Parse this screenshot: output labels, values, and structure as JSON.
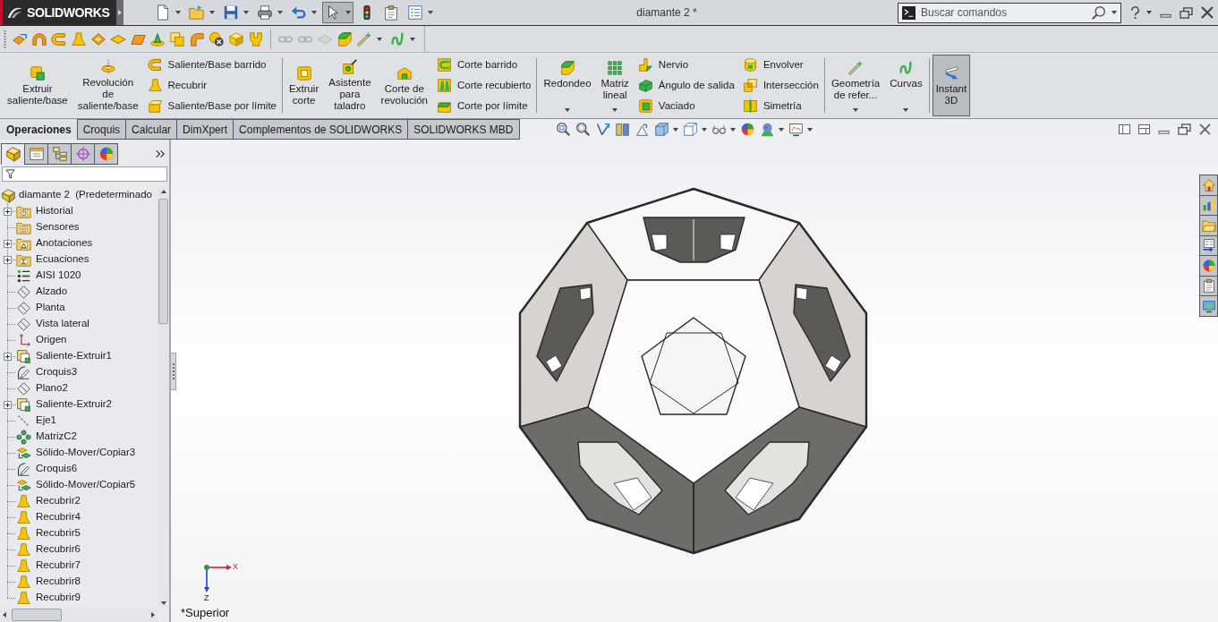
{
  "titlebar": {
    "logo": "SOLIDWORKS",
    "title": "diamante 2 *",
    "search_placeholder": "Buscar comandos"
  },
  "quick_access": [
    {
      "kind": "new",
      "dropdown": true,
      "selected": false
    },
    {
      "kind": "open",
      "dropdown": true,
      "selected": false
    },
    {
      "kind": "save",
      "dropdown": true,
      "selected": false
    },
    {
      "kind": "print",
      "dropdown": true,
      "selected": false
    },
    {
      "kind": "undo",
      "dropdown": true,
      "selected": false
    },
    {
      "kind": "select",
      "dropdown": true,
      "selected": true
    },
    {
      "kind": "rebuild",
      "dropdown": false,
      "selected": false
    },
    {
      "kind": "properties",
      "dropdown": false,
      "selected": false
    },
    {
      "kind": "options",
      "dropdown": true,
      "selected": false
    }
  ],
  "features_toolbar": [
    {
      "items": [
        {
          "kind": "tile",
          "disabled": false,
          "dropdown": false
        },
        {
          "kind": "arch",
          "disabled": false,
          "dropdown": false
        },
        {
          "kind": "csweep",
          "disabled": false,
          "dropdown": false
        },
        {
          "kind": "bell",
          "disabled": false,
          "dropdown": false
        },
        {
          "kind": "diamond",
          "disabled": false,
          "dropdown": false
        },
        {
          "kind": "flatdiamond",
          "disabled": false,
          "dropdown": false
        },
        {
          "kind": "plate",
          "disabled": false,
          "dropdown": false
        },
        {
          "kind": "cone",
          "disabled": false,
          "dropdown": false
        },
        {
          "kind": "stack",
          "disabled": false,
          "dropdown": false
        },
        {
          "kind": "elbow",
          "disabled": false,
          "dropdown": false
        },
        {
          "kind": "crossdisc",
          "disabled": false,
          "dropdown": false
        },
        {
          "kind": "cube",
          "disabled": false,
          "dropdown": false
        },
        {
          "kind": "fork",
          "disabled": false,
          "dropdown": false
        }
      ]
    },
    {
      "items": [
        {
          "kind": "chain",
          "disabled": true,
          "dropdown": false
        },
        {
          "kind": "chain",
          "disabled": true,
          "dropdown": false
        },
        {
          "kind": "flatdiamond",
          "disabled": true,
          "dropdown": false
        },
        {
          "kind": "fillet",
          "disabled": false,
          "dropdown": false
        },
        {
          "kind": "refgeometry",
          "disabled": false,
          "dropdown": true
        },
        {
          "kind": "curves",
          "disabled": false,
          "dropdown": true
        }
      ]
    }
  ],
  "ribbon": [
    {
      "buttons": [
        {
          "kind": "extrude",
          "label": "Extruir\nsaliente/base",
          "dropdown": false,
          "selected": false
        },
        {
          "kind": "revolve",
          "label": "Revolución\nde\nsaliente/base",
          "dropdown": false,
          "selected": false
        }
      ],
      "stacks": [
        [
          {
            "kind": "csweep",
            "label": "Saliente/Base barrido"
          },
          {
            "kind": "bell",
            "label": "Recubrir"
          },
          {
            "kind": "boundary",
            "label": "Saliente/Base por límite"
          }
        ]
      ]
    },
    {
      "buttons": [
        {
          "kind": "cutextrude",
          "label": "Extruir\ncorte",
          "dropdown": false,
          "selected": false
        },
        {
          "kind": "hole",
          "label": "Asistente\npara\ntaladro",
          "dropdown": false,
          "selected": false
        },
        {
          "kind": "cutrevolve",
          "label": "Corte de\nrevolución",
          "dropdown": false,
          "selected": false
        }
      ],
      "stacks": [
        [
          {
            "kind": "cutsweep",
            "label": "Corte barrido"
          },
          {
            "kind": "cutloft",
            "label": "Corte recubierto"
          },
          {
            "kind": "cutboundary",
            "label": "Corte por límite"
          }
        ]
      ]
    },
    {
      "buttons": [
        {
          "kind": "fillet",
          "label": "Redondeo",
          "dropdown": true,
          "selected": false
        },
        {
          "kind": "pattern",
          "label": "Matriz\nlineal",
          "dropdown": true,
          "selected": false
        }
      ],
      "stacks": [
        [
          {
            "kind": "rib",
            "label": "Nervio"
          },
          {
            "kind": "draft",
            "label": "Ángulo de salida"
          },
          {
            "kind": "shell",
            "label": "Vaciado"
          }
        ],
        [
          {
            "kind": "wrap",
            "label": "Envolver"
          },
          {
            "kind": "intersect",
            "label": "Intersección"
          },
          {
            "kind": "mirror",
            "label": "Simetría"
          }
        ]
      ]
    },
    {
      "buttons": [
        {
          "kind": "refgeometry",
          "label": "Geometría\nde refer...",
          "dropdown": true,
          "selected": false
        },
        {
          "kind": "curves",
          "label": "Curvas",
          "dropdown": true,
          "selected": false
        }
      ]
    },
    {
      "buttons": [
        {
          "kind": "instant3d",
          "label": "Instant\n3D",
          "dropdown": false,
          "selected": true
        }
      ]
    }
  ],
  "tabs": [
    {
      "label": "Operaciones",
      "selected": true
    },
    {
      "label": "Croquis",
      "selected": false
    },
    {
      "label": "Calcular",
      "selected": false
    },
    {
      "label": "DimXpert",
      "selected": false
    },
    {
      "label": "Complementos de SOLIDWORKS",
      "selected": false
    },
    {
      "label": "SOLIDWORKS MBD",
      "selected": false
    }
  ],
  "view_toolbar": [
    {
      "kind": "zoomfit",
      "dropdown": false
    },
    {
      "kind": "zoomarea",
      "dropdown": false
    },
    {
      "kind": "previous",
      "dropdown": false
    },
    {
      "kind": "section",
      "dropdown": false
    },
    {
      "kind": "annotation",
      "dropdown": false
    },
    {
      "kind": "orientation",
      "dropdown": true
    },
    {
      "kind": "displaystyle",
      "dropdown": true
    },
    {
      "kind": "hideshow",
      "dropdown": true
    },
    {
      "kind": "appearance",
      "dropdown": false
    },
    {
      "kind": "scene",
      "dropdown": true
    },
    {
      "kind": "viewsettings",
      "dropdown": true
    }
  ],
  "panel": {
    "tabs": [
      {
        "kind": "featuremanager",
        "selected": true
      },
      {
        "kind": "propertymanager",
        "selected": false
      },
      {
        "kind": "configurationmanager",
        "selected": false
      },
      {
        "kind": "dimxpert",
        "selected": false
      },
      {
        "kind": "displaymanager",
        "selected": false
      }
    ],
    "tree": {
      "kind": "part",
      "label": "diamante 2  (Predeterminado",
      "children": [
        {
          "kind": "history",
          "label": "Historial",
          "expanded": false
        },
        {
          "kind": "sensors",
          "label": "Sensores"
        },
        {
          "kind": "annotations",
          "label": "Anotaciones",
          "expanded": false
        },
        {
          "kind": "equations",
          "label": "Ecuaciones",
          "expanded": false
        },
        {
          "kind": "material",
          "label": "AISI 1020"
        },
        {
          "kind": "plane",
          "label": "Alzado"
        },
        {
          "kind": "plane",
          "label": "Planta"
        },
        {
          "kind": "plane",
          "label": "Vista lateral"
        },
        {
          "kind": "origin",
          "label": "Origen"
        },
        {
          "kind": "featureextrude",
          "label": "Saliente-Extruir1",
          "expanded": false
        },
        {
          "kind": "sketch",
          "label": "Croquis3"
        },
        {
          "kind": "plane",
          "label": "Plano2"
        },
        {
          "kind": "featureextrude",
          "label": "Saliente-Extruir2",
          "expanded": false
        },
        {
          "kind": "axis",
          "label": "Eje1"
        },
        {
          "kind": "circpattern",
          "label": "MatrizC2"
        },
        {
          "kind": "movecopy",
          "label": "Sólido-Mover/Copiar3"
        },
        {
          "kind": "sketch",
          "label": "Croquis6"
        },
        {
          "kind": "movecopy",
          "label": "Sólido-Mover/Copiar5"
        },
        {
          "kind": "loft",
          "label": "Recubrir2"
        },
        {
          "kind": "loft",
          "label": "Recubrir4"
        },
        {
          "kind": "loft",
          "label": "Recubrir5"
        },
        {
          "kind": "loft",
          "label": "Recubrir6"
        },
        {
          "kind": "loft",
          "label": "Recubrir7"
        },
        {
          "kind": "loft",
          "label": "Recubrir8"
        },
        {
          "kind": "loft",
          "label": "Recubrir9"
        }
      ]
    }
  },
  "viewport": {
    "view_name": "*Superior",
    "triad": {
      "x_label": "X",
      "z_label": "Z"
    }
  },
  "task_pane": [
    {
      "kind": "home"
    },
    {
      "kind": "resources"
    },
    {
      "kind": "library"
    },
    {
      "kind": "explorer"
    },
    {
      "kind": "appearances"
    },
    {
      "kind": "customprops"
    },
    {
      "kind": "forum"
    }
  ]
}
